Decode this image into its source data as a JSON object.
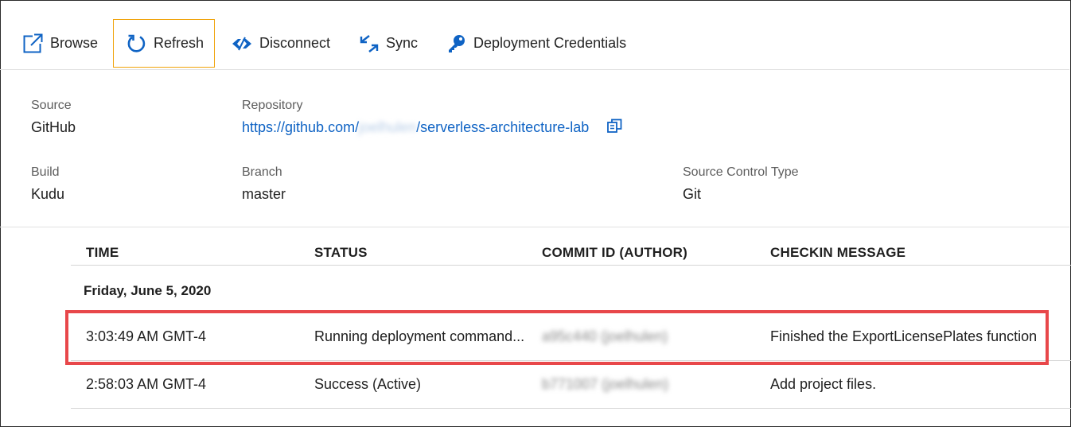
{
  "toolbar": {
    "browse": "Browse",
    "refresh": "Refresh",
    "disconnect": "Disconnect",
    "sync": "Sync",
    "credentials": "Deployment Credentials"
  },
  "info": {
    "source_label": "Source",
    "source_value": "GitHub",
    "repository_label": "Repository",
    "repository_prefix": "https://github.com/",
    "repository_owner": "joelhulen",
    "repository_suffix": "/serverless-architecture-lab",
    "build_label": "Build",
    "build_value": "Kudu",
    "branch_label": "Branch",
    "branch_value": "master",
    "sct_label": "Source Control Type",
    "sct_value": "Git"
  },
  "table": {
    "headers": [
      "TIME",
      "STATUS",
      "COMMIT ID (AUTHOR)",
      "CHECKIN MESSAGE"
    ],
    "group_date": "Friday, June 5, 2020",
    "rows": [
      {
        "time": "3:03:49 AM GMT-4",
        "status": "Running deployment command...",
        "commit": "a95c440 (joelhulen)",
        "message": "Finished the ExportLicensePlates function"
      },
      {
        "time": "2:58:03 AM GMT-4",
        "status": "Success (Active)",
        "commit": "b771007 (joelhulen)",
        "message": "Add project files."
      }
    ]
  },
  "colors": {
    "accent": "#0f63c4",
    "focus_border": "#f0a30a",
    "highlight": "#e8474a"
  }
}
